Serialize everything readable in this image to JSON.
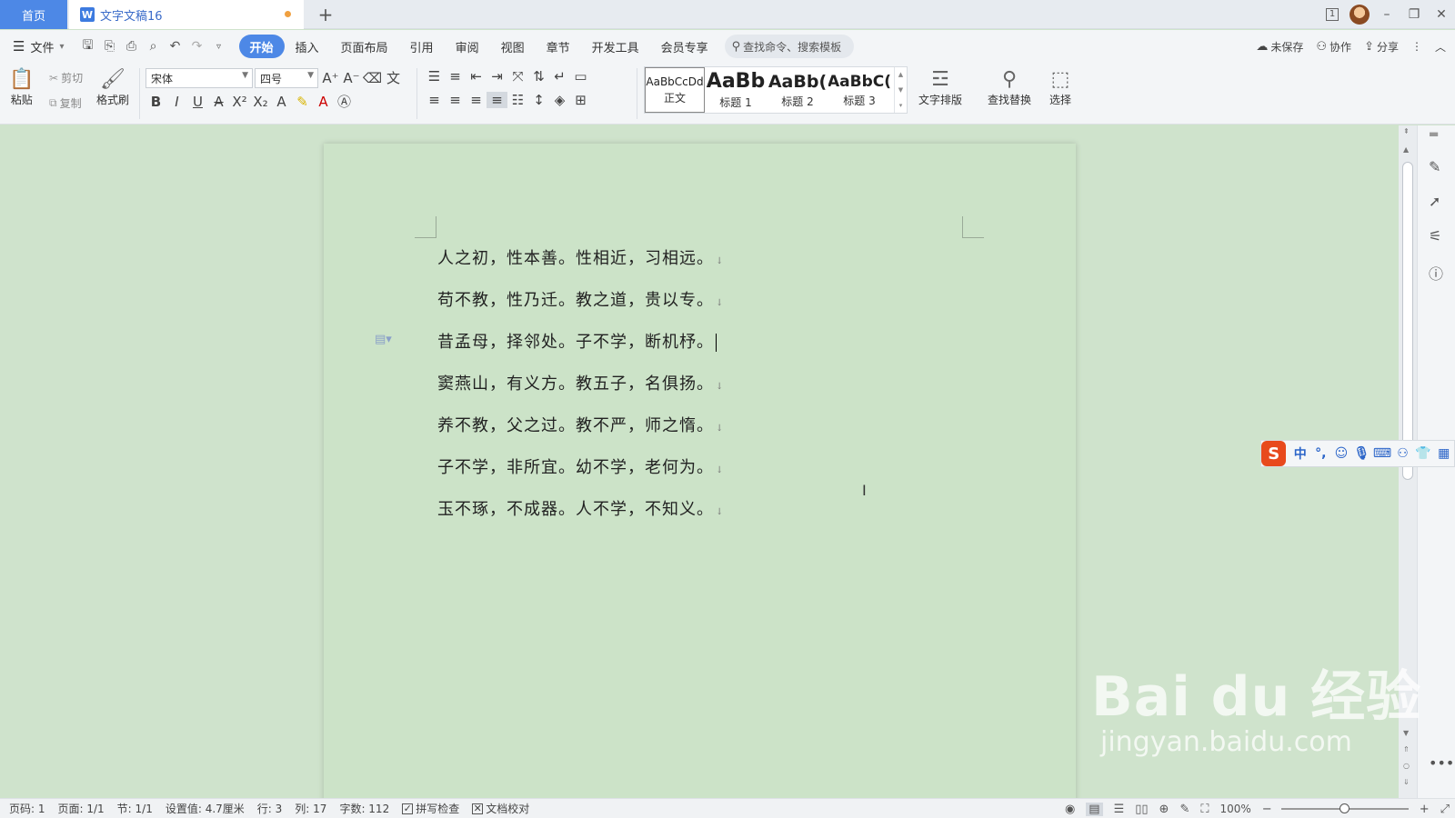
{
  "titlebar": {
    "home_tab": "首页",
    "doc_tab": "文字文稿16",
    "doc_icon": "W",
    "add_tab": "+",
    "window_count": "1"
  },
  "menubar": {
    "file_label": "文件",
    "items": [
      "开始",
      "插入",
      "页面布局",
      "引用",
      "审阅",
      "视图",
      "章节",
      "开发工具",
      "会员专享"
    ],
    "search_placeholder": "查找命令、搜索模板",
    "right": {
      "unsaved": "未保存",
      "collab": "协作",
      "share": "分享"
    }
  },
  "ribbon": {
    "paste": "粘贴",
    "cut": "剪切",
    "copy": "复制",
    "format_painter": "格式刷",
    "font_name": "宋体",
    "font_size": "四号",
    "styles": [
      {
        "sample": "AaBbCcDd",
        "name": "正文"
      },
      {
        "sample": "AaBb",
        "name": "标题 1"
      },
      {
        "sample": "AaBb(",
        "name": "标题 2"
      },
      {
        "sample": "AaBbC(",
        "name": "标题 3"
      }
    ],
    "text_layout": "文字排版",
    "find_replace": "查找替换",
    "select": "选择"
  },
  "document": {
    "paragraphs": [
      "人之初，性本善。性相近，习相远。",
      "苟不教，性乃迁。教之道，贵以专。",
      "昔孟母，择邻处。子不学，断机杼。",
      "窦燕山，有义方。教五子，名俱扬。",
      "养不教，父之过。教不严，师之惰。",
      "子不学，非所宜。幼不学，老何为。",
      "玉不琢，不成器。人不学，不知义。"
    ],
    "para_mark": "↓"
  },
  "ime": {
    "logo": "S",
    "lang": "中"
  },
  "watermark": {
    "brand": "Bai du 经验",
    "url": "jingyan.baidu.com"
  },
  "statusbar": {
    "page_code": "页码: 1",
    "page": "页面: 1/1",
    "section": "节: 1/1",
    "setting": "设置值: 4.7厘米",
    "row": "行: 3",
    "col": "列: 17",
    "word_count": "字数: 112",
    "spell_check": "拼写检查",
    "doc_proof": "文档校对",
    "zoom": "100%"
  }
}
